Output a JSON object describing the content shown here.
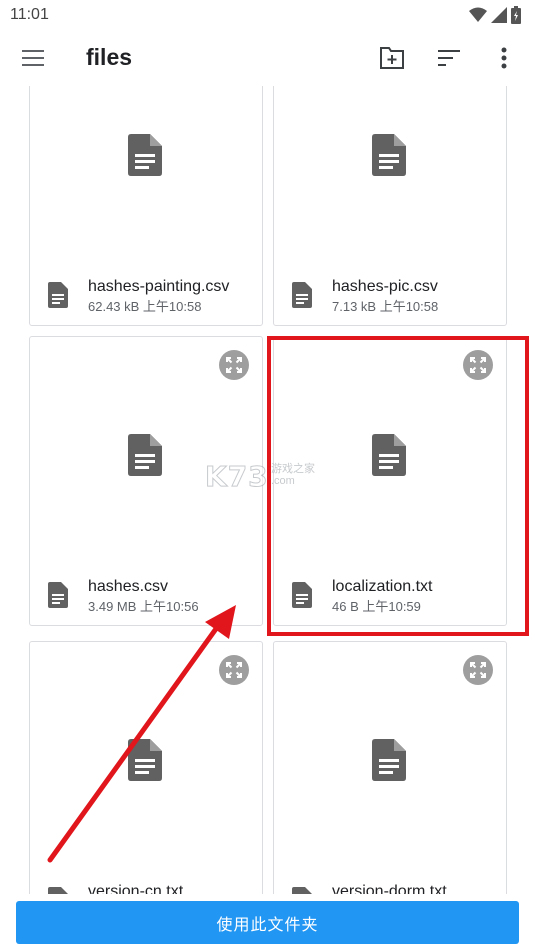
{
  "status_bar": {
    "time": "11:01"
  },
  "app_bar": {
    "title": "files",
    "menu_icon": "hamburger-menu-icon",
    "actions": [
      "new-folder-icon",
      "sort-icon",
      "more-vert-icon"
    ]
  },
  "files": [
    {
      "name": "hashes-painting.csv",
      "info": "62.43 kB 上午10:58"
    },
    {
      "name": "hashes-pic.csv",
      "info": "7.13 kB 上午10:58"
    },
    {
      "name": "hashes.csv",
      "info": "3.49 MB 上午10:56"
    },
    {
      "name": "localization.txt",
      "info": "46 B 上午10:59"
    },
    {
      "name": "version-cn.txt",
      "info": ""
    },
    {
      "name": "version-dorm.txt",
      "info": ""
    }
  ],
  "watermark": {
    "brand": "K73",
    "sub": "游戏之家",
    "domain": ".com"
  },
  "bottom": {
    "use_folder_label": "使用此文件夹"
  },
  "colors": {
    "accent": "#2196f3",
    "highlight": "#e0161c",
    "icon": "#616161"
  }
}
